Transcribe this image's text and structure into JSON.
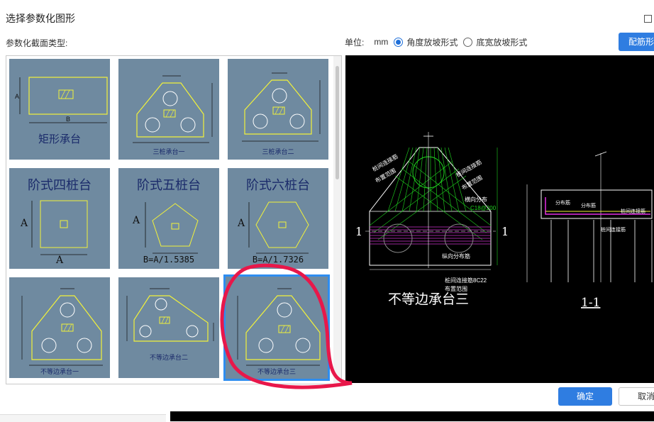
{
  "dialog": {
    "title": "选择参数化图形",
    "section_label": "参数化截面类型:"
  },
  "unit_bar": {
    "unit_label": "单位:",
    "unit_value": "mm",
    "option_angle": "角度放坡形式",
    "option_bottom_width": "底宽放坡形式",
    "selected": "角度放坡形式"
  },
  "buttons": {
    "rebar_label": "配筋形",
    "ok_label": "确定",
    "cancel_label": "取消"
  },
  "shapes": [
    {
      "label": "矩形承台"
    },
    {
      "label": "三桩承台一"
    },
    {
      "label": "三桩承台二"
    },
    {
      "label": "阶式四桩台",
      "dim_a": "A",
      "dim_b": "A"
    },
    {
      "label": "阶式五桩台",
      "dim_a": "A",
      "dim_b": "B=A/1.5385"
    },
    {
      "label": "阶式六桩台",
      "dim_a": "A",
      "dim_b": "B=A/1.7326"
    },
    {
      "label": "不等边承台一"
    },
    {
      "label": "不等边承台二"
    },
    {
      "label": "不等边承台三",
      "selected": true
    }
  ],
  "preview": {
    "title": "不等边承台三",
    "section_label": "1-1",
    "cut_mark": "1",
    "annotations": {
      "pile_rebar": "桩间连接筋",
      "layout_range": "布置范围",
      "vertical_dist": "纵向分布筋",
      "cross_dist": "横向分布",
      "dist_rebar": "分布筋",
      "rebar_spec": "C18@200",
      "rebar_spec2": "桩间连接筋8C22"
    }
  },
  "colors": {
    "accent": "#2f7de1",
    "tile_bg": "#6f8aa0",
    "cad_bg": "#000000",
    "shape_line": "#f2f23a",
    "annotation_red": "#e8174a"
  }
}
